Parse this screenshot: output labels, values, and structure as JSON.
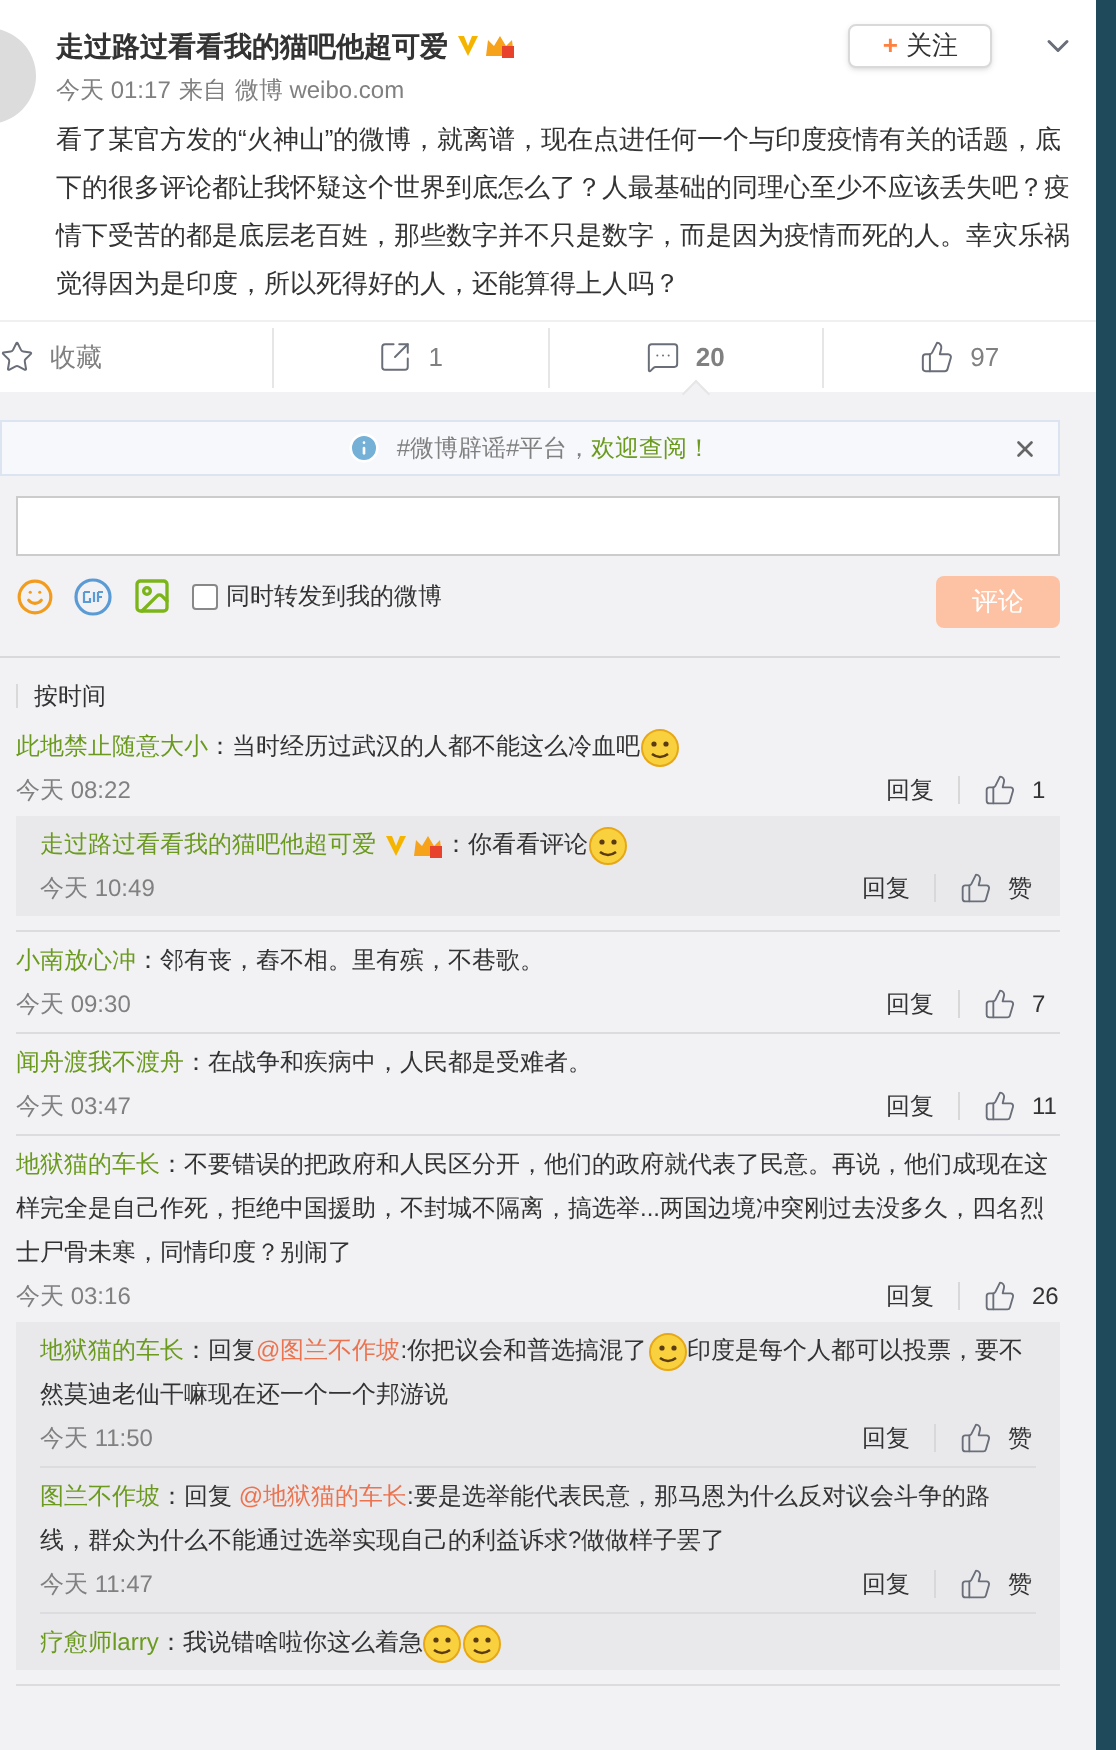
{
  "post": {
    "author": "走过路过看看我的猫吧他超可爱",
    "verified": true,
    "time": "今天 01:17",
    "source_prefix": "来自",
    "source": "微博 weibo.com",
    "text": "看了某官方发的“火神山”的微博，就离谱，现在点进任何一个与印度疫情有关的话题，底下的很多评论都让我怀疑这个世界到底怎么了？人最基础的同理心至少不应该丢失吧？疫情下受苦的都是底层老百姓，那些数字并不只是数字，而是因为疫情而死的人。幸灾乐祸觉得因为是印度，所以死得好的人，还能算得上人吗？",
    "follow_icon": "+",
    "follow_label": "关注"
  },
  "actions": [
    {
      "kind": "favorite",
      "label": "收藏",
      "selected": false
    },
    {
      "kind": "share",
      "label": "1",
      "selected": false
    },
    {
      "kind": "comment",
      "label": "20",
      "selected": true
    },
    {
      "kind": "like",
      "label": "97",
      "selected": false
    }
  ],
  "notice": {
    "text": "#微博辟谣#平台，",
    "link": "欢迎查阅！"
  },
  "composer": {
    "repost_label": "同时转发到我的微博",
    "repost_checked": false,
    "submit": "评论",
    "submit_disabled": true
  },
  "sort": {
    "label": "按时间"
  },
  "comments": [
    {
      "author": "此地禁止随意大小",
      "verified": false,
      "segments": [
        {
          "kind": "text",
          "text": "：当时经历过武汉的人都不能这么冷血吧"
        },
        {
          "kind": "emoji"
        }
      ],
      "time": "今天 08:22",
      "reply": "回复",
      "likes": "1",
      "replies": [
        {
          "author": "走过路过看看我的猫吧他超可爱",
          "verified": true,
          "segments": [
            {
              "kind": "text",
              "text": "：你看看评论"
            },
            {
              "kind": "emoji"
            }
          ],
          "time": "今天 10:49",
          "reply": "回复",
          "likes": "赞"
        }
      ]
    },
    {
      "author": "小南放心冲",
      "verified": false,
      "segments": [
        {
          "kind": "text",
          "text": "：邻有丧，舂不相。里有殡，不巷歌。"
        }
      ],
      "time": "今天 09:30",
      "reply": "回复",
      "likes": "7"
    },
    {
      "author": "闻舟渡我不渡舟",
      "verified": false,
      "segments": [
        {
          "kind": "text",
          "text": "：在战争和疾病中，人民都是受难者。"
        }
      ],
      "time": "今天 03:47",
      "reply": "回复",
      "likes": "11"
    },
    {
      "author": "地狱猫的车长",
      "verified": false,
      "segments": [
        {
          "kind": "text",
          "text": "：不要错误的把政府和人民区分开，他们的政府就代表了民意。再说，他们成现在这样完全是自己作死，拒绝中国援助，不封城不隔离，搞选举...两国边境冲突刚过去没多久，四名烈士尸骨未寒，同情印度？别闹了"
        }
      ],
      "time": "今天 03:16",
      "reply": "回复",
      "likes": "26",
      "replies": [
        {
          "author": "地狱猫的车长",
          "verified": false,
          "segments": [
            {
              "kind": "text",
              "text": "：回复"
            },
            {
              "kind": "mention",
              "text": "@图兰不作坡"
            },
            {
              "kind": "text",
              "text": ":你把议会和普选搞混了"
            },
            {
              "kind": "emoji"
            },
            {
              "kind": "text",
              "text": "印度是每个人都可以投票，要不然莫迪老仙干嘛现在还一个一个邦游说"
            }
          ],
          "time": "今天 11:50",
          "reply": "回复",
          "likes": "赞"
        },
        {
          "author": "图兰不作坡",
          "verified": false,
          "segments": [
            {
              "kind": "text",
              "text": "：回复 "
            },
            {
              "kind": "mention",
              "text": "@地狱猫的车长"
            },
            {
              "kind": "text",
              "text": ":要是选举能代表民意，那马恩为什么反对议会斗争的路线，群众为什么不能通过选举实现自己的利益诉求?做做样子罢了"
            }
          ],
          "time": "今天 11:47",
          "reply": "回复",
          "likes": "赞"
        },
        {
          "author": "疗愈师larry",
          "verified": false,
          "segments": [
            {
              "kind": "text",
              "text": "：我说错啥啦你这么着急"
            },
            {
              "kind": "emoji"
            },
            {
              "kind": "emoji"
            }
          ]
        }
      ]
    }
  ]
}
